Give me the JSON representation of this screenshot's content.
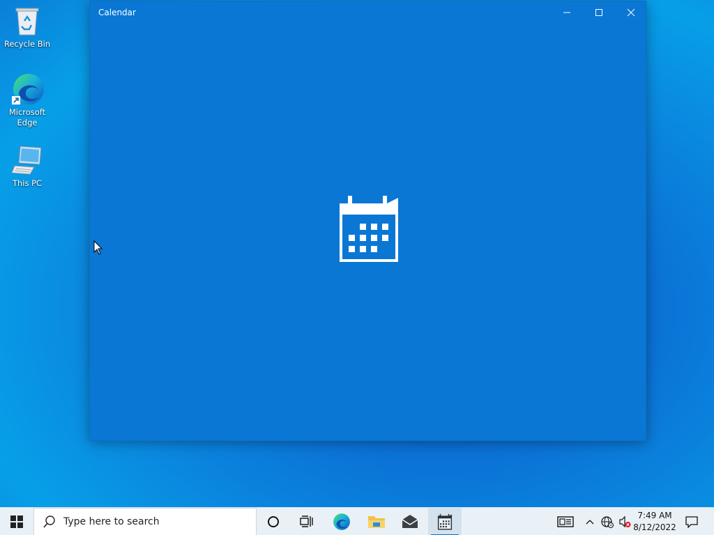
{
  "desktop": {
    "icons": [
      {
        "label": "Recycle Bin",
        "icon": "recycle-bin-icon"
      },
      {
        "label": "Microsoft\nEdge",
        "icon": "edge-icon"
      },
      {
        "label": "This PC",
        "icon": "this-pc-icon"
      }
    ]
  },
  "window": {
    "title": "Calendar",
    "background_color": "#0a77d5",
    "controls": {
      "minimize": "minimize-icon",
      "maximize": "maximize-icon",
      "close": "close-icon"
    },
    "splash_icon": "calendar-icon"
  },
  "taskbar": {
    "start_icon": "windows-logo-icon",
    "search": {
      "placeholder": "Type here to search"
    },
    "pinned": [
      {
        "name": "cortana",
        "icon": "circle-icon"
      },
      {
        "name": "task-view",
        "icon": "task-view-icon"
      },
      {
        "name": "edge",
        "icon": "edge-icon"
      },
      {
        "name": "file-explorer",
        "icon": "folder-icon"
      },
      {
        "name": "mail",
        "icon": "mail-icon"
      },
      {
        "name": "calendar",
        "icon": "calendar-icon",
        "active": true
      }
    ],
    "tray": {
      "icons": [
        "news-icon",
        "chevron-up-icon",
        "network-icon",
        "volume-muted-icon"
      ],
      "time": "7:49 AM",
      "date": "8/12/2022",
      "notification_icon": "notification-icon"
    },
    "accent_color": "#0a6fd0"
  }
}
